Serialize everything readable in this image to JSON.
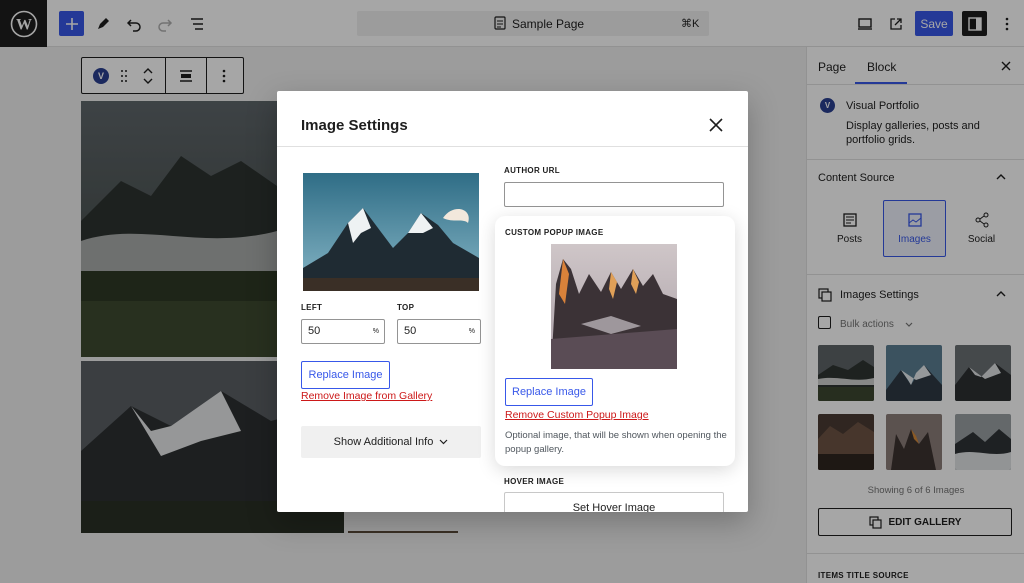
{
  "topbar": {
    "document_title": "Sample Page",
    "shortcut": "⌘K",
    "save_label": "Save"
  },
  "block_toolbar": {
    "block_icon_letter": "V"
  },
  "sidebar": {
    "tabs": [
      "Page",
      "Block"
    ],
    "active_tab": "Block",
    "block_name": "Visual Portfolio",
    "block_description": "Display galleries, posts and portfolio grids.",
    "content_source_title": "Content Source",
    "sources": [
      {
        "label": "Posts",
        "icon": "posts-icon",
        "active": false
      },
      {
        "label": "Images",
        "icon": "images-icon",
        "active": true
      },
      {
        "label": "Social",
        "icon": "social-icon",
        "active": false
      }
    ],
    "images_settings_title": "Images Settings",
    "bulk_actions_label": "Bulk actions",
    "showing_text": "Showing 6 of 6 Images",
    "edit_gallery_label": "EDIT GALLERY",
    "items_title_source_label": "ITEMS TITLE SOURCE"
  },
  "modal": {
    "title": "Image Settings",
    "left_label": "LEFT",
    "left_value": "50",
    "top_label": "TOP",
    "top_value": "50",
    "unit": "%",
    "replace_image_label": "Replace Image",
    "remove_from_gallery_label": "Remove Image from Gallery",
    "show_additional_info_label": "Show Additional Info",
    "author_url_label": "AUTHOR URL",
    "author_url_value": "",
    "custom_popup_label": "CUSTOM POPUP IMAGE",
    "popup_replace_label": "Replace Image",
    "remove_custom_popup_label": "Remove Custom Popup Image",
    "popup_help_text": "Optional image, that will be shown when opening the popup gallery.",
    "hover_image_label": "HOVER IMAGE",
    "set_hover_image_label": "Set Hover Image"
  },
  "colors": {
    "accent": "#3858e9",
    "danger": "#cc1818",
    "dark": "#1e1e1e"
  }
}
